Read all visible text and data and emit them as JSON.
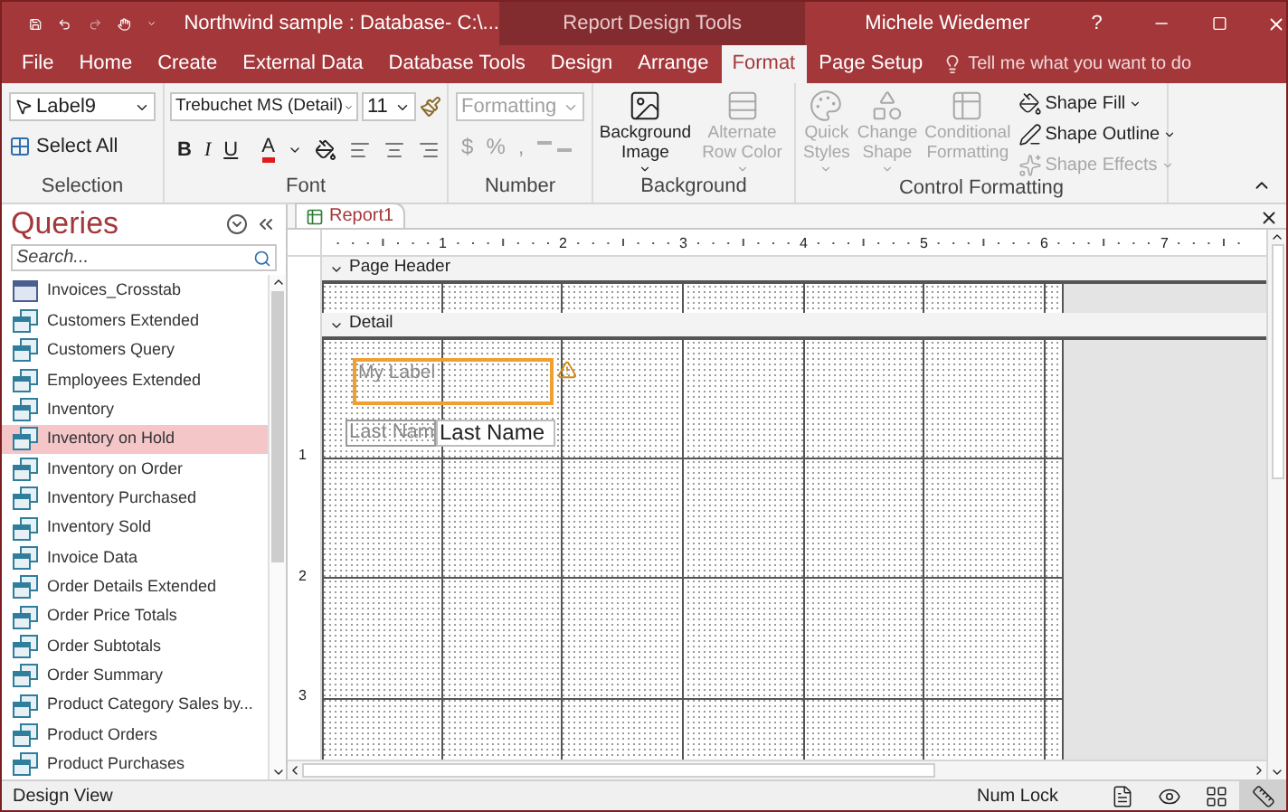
{
  "title_bar": {
    "title": "Northwind sample : Database- C:\\...",
    "context_label": "Report Design Tools",
    "user": "Michele Wiedemer",
    "help": "?"
  },
  "tabs": [
    {
      "label": "File",
      "selected": false
    },
    {
      "label": "Home",
      "selected": false
    },
    {
      "label": "Create",
      "selected": false
    },
    {
      "label": "External Data",
      "selected": false
    },
    {
      "label": "Database Tools",
      "selected": false
    },
    {
      "label": "Design",
      "selected": false
    },
    {
      "label": "Arrange",
      "selected": false
    },
    {
      "label": "Format",
      "selected": true
    },
    {
      "label": "Page Setup",
      "selected": false
    }
  ],
  "tell_me": {
    "placeholder": "Tell me what you want to do"
  },
  "ribbon": {
    "selection": {
      "label": "Selection",
      "object_combo": "Label9",
      "select_all": "Select All"
    },
    "font": {
      "label": "Font",
      "font_name": "Trebuchet MS (Detail)",
      "font_size": "11",
      "styles": [
        "B",
        "I",
        "U"
      ],
      "font_color_glyph": "A"
    },
    "number": {
      "label": "Number",
      "format_placeholder": "Formatting",
      "disabled": true,
      "symbols": [
        "$",
        "%",
        ","
      ]
    },
    "background": {
      "label": "Background",
      "buttons": [
        {
          "label": "Background Image",
          "kind": "image",
          "disabled": false,
          "dropdown": true
        },
        {
          "label": "Alternate Row Color",
          "kind": "rows",
          "disabled": true,
          "dropdown": true
        }
      ]
    },
    "control_formatting": {
      "label": "Control Formatting",
      "large_buttons": [
        {
          "label": "Quick Styles",
          "kind": "styles",
          "disabled": true,
          "dropdown": true
        },
        {
          "label": "Change Shape",
          "kind": "shape",
          "disabled": true,
          "dropdown": true
        },
        {
          "label": "Conditional Formatting",
          "kind": "conditional",
          "disabled": true,
          "dropdown": false
        }
      ],
      "small_buttons": [
        {
          "label": "Shape Fill",
          "kind": "fill",
          "disabled": false
        },
        {
          "label": "Shape Outline",
          "kind": "outline",
          "disabled": false
        },
        {
          "label": "Shape Effects",
          "kind": "effects",
          "disabled": true
        }
      ]
    }
  },
  "nav": {
    "title": "Queries",
    "search_placeholder": "Search...",
    "items": [
      {
        "label": "Invoices_Crosstab",
        "kind": "crosstab",
        "selected": false
      },
      {
        "label": "Customers Extended",
        "kind": "select",
        "selected": false
      },
      {
        "label": "Customers Query",
        "kind": "select",
        "selected": false
      },
      {
        "label": "Employees Extended",
        "kind": "select",
        "selected": false
      },
      {
        "label": "Inventory",
        "kind": "select",
        "selected": false
      },
      {
        "label": "Inventory on Hold",
        "kind": "select",
        "selected": true
      },
      {
        "label": "Inventory on Order",
        "kind": "select",
        "selected": false
      },
      {
        "label": "Inventory Purchased",
        "kind": "select",
        "selected": false
      },
      {
        "label": "Inventory Sold",
        "kind": "select",
        "selected": false
      },
      {
        "label": "Invoice Data",
        "kind": "select",
        "selected": false
      },
      {
        "label": "Order Details Extended",
        "kind": "select",
        "selected": false
      },
      {
        "label": "Order Price Totals",
        "kind": "select",
        "selected": false
      },
      {
        "label": "Order Subtotals",
        "kind": "select",
        "selected": false
      },
      {
        "label": "Order Summary",
        "kind": "select",
        "selected": false
      },
      {
        "label": "Product Category Sales by...",
        "kind": "select",
        "selected": false
      },
      {
        "label": "Product Orders",
        "kind": "select",
        "selected": false
      },
      {
        "label": "Product Purchases",
        "kind": "select",
        "selected": false
      }
    ]
  },
  "document": {
    "tab": "Report1",
    "ruler_numbers": [
      "1",
      "2",
      "3",
      "4",
      "5",
      "6",
      "7"
    ],
    "vertical_ruler_numbers": [
      "1",
      "2",
      "3"
    ],
    "sections": [
      {
        "label": "Page Header"
      },
      {
        "label": "Detail"
      }
    ],
    "controls": [
      {
        "text": "My Label",
        "kind": "label",
        "selected": true
      },
      {
        "text": "Last Nam",
        "kind": "label",
        "selected": false
      },
      {
        "text": "Last Name",
        "kind": "textbox",
        "selected": false
      }
    ]
  },
  "status_bar": {
    "mode": "Design View",
    "indicator": "Num Lock",
    "views": [
      {
        "kind": "report",
        "selected": false
      },
      {
        "kind": "preview",
        "selected": false
      },
      {
        "kind": "layout",
        "selected": false
      },
      {
        "kind": "design",
        "selected": true
      }
    ]
  }
}
